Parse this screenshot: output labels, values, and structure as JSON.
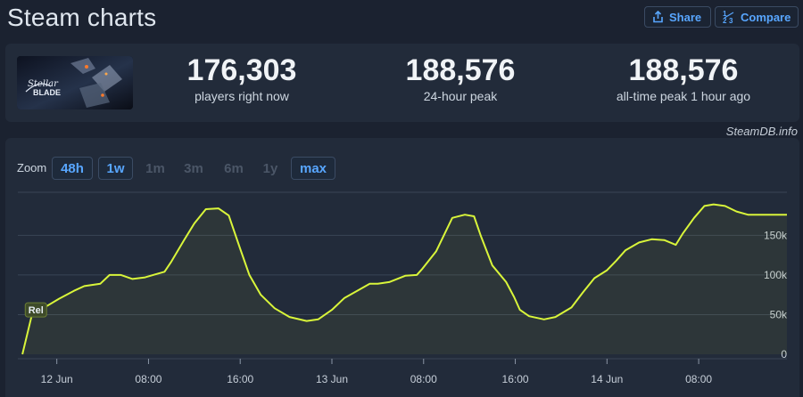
{
  "header": {
    "title": "Steam charts",
    "share_label": "Share",
    "compare_label": "Compare"
  },
  "stats": [
    {
      "value": "176,303",
      "label": "players right now"
    },
    {
      "value": "188,576",
      "label": "24-hour peak"
    },
    {
      "value": "188,576",
      "label": "all-time peak 1 hour ago"
    }
  ],
  "game_logo_text": "Stellar BLADE",
  "credit": "SteamDB.info",
  "zoom": {
    "label": "Zoom",
    "options": [
      {
        "label": "48h",
        "active": true
      },
      {
        "label": "1w",
        "active": true
      },
      {
        "label": "1m",
        "active": false
      },
      {
        "label": "3m",
        "active": false
      },
      {
        "label": "6m",
        "active": false
      },
      {
        "label": "1y",
        "active": false
      },
      {
        "label": "max",
        "active": true
      }
    ]
  },
  "chart_data": {
    "type": "line",
    "title": "",
    "xlabel": "",
    "ylabel": "",
    "x_unit": "hours since 12 Jun 00:00",
    "xlim": [
      -3.4,
      63.7
    ],
    "ylim": [
      0,
      188576
    ],
    "y_ticks": [
      0,
      50000,
      100000,
      150000
    ],
    "y_tick_labels": [
      "0",
      "50k",
      "100k",
      "150k"
    ],
    "x_ticks": [
      0,
      8,
      16,
      24,
      32,
      40,
      48,
      56
    ],
    "x_tick_labels": [
      "12 Jun",
      "08:00",
      "16:00",
      "13 Jun",
      "08:00",
      "16:00",
      "14 Jun",
      "08:00"
    ],
    "grid": true,
    "line_color": "#d9f53a",
    "marker_label": "Rel",
    "series": [
      {
        "x": [
          -3.0,
          -2.2,
          -1.2,
          0.2,
          1.5,
          2.4,
          3.8,
          4.6,
          5.6,
          6.6,
          7.7,
          8.4,
          9.4,
          10.0,
          11.1,
          12.0,
          13.0,
          14.1,
          15.0,
          16.0,
          16.8,
          17.8,
          19.0,
          20.3,
          21.8,
          22.8,
          24.0,
          25.1,
          26.2,
          27.3,
          28.0,
          29.0,
          30.4,
          31.4,
          31.9,
          33.1,
          34.5,
          35.6,
          36.4,
          37.0,
          38.0,
          39.2,
          39.9,
          40.4,
          41.2,
          42.5,
          43.5,
          44.9,
          45.9,
          46.9,
          48.0,
          48.8,
          49.6,
          50.8,
          51.9,
          53.0,
          54.0,
          54.6,
          55.6,
          56.5,
          57.3,
          58.3,
          59.3,
          60.3,
          61.6,
          62.6,
          63.7
        ],
        "y": [
          0,
          48000,
          58000,
          70000,
          80000,
          86000,
          89000,
          100000,
          100000,
          95000,
          97000,
          100000,
          104000,
          117000,
          144000,
          165000,
          183000,
          184000,
          175000,
          133000,
          100000,
          75000,
          58000,
          47000,
          42000,
          44000,
          56000,
          71000,
          80000,
          89000,
          89000,
          91000,
          99000,
          100000,
          108000,
          130000,
          172000,
          176000,
          174000,
          149000,
          112000,
          91000,
          72000,
          56000,
          48000,
          44000,
          47000,
          59000,
          78000,
          96000,
          106000,
          118000,
          131000,
          141000,
          145000,
          144000,
          138000,
          152000,
          172000,
          187000,
          189000,
          187000,
          180000,
          176000,
          176000,
          176000,
          176000
        ]
      }
    ]
  }
}
